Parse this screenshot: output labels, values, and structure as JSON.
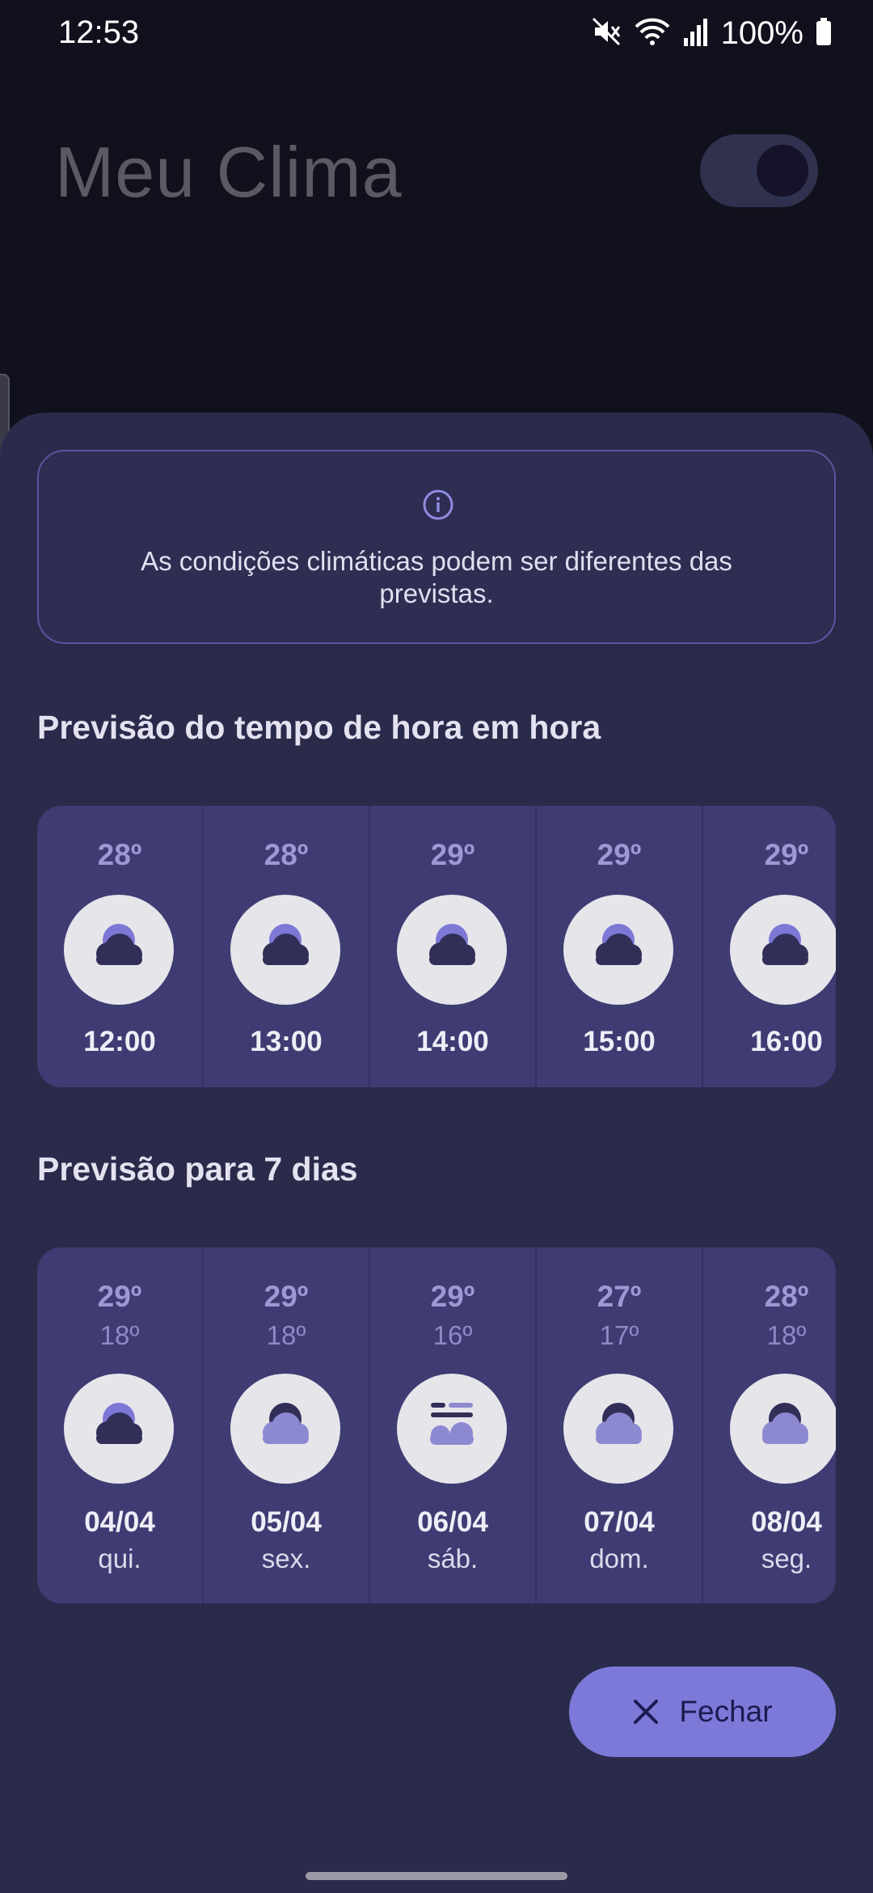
{
  "status_bar": {
    "time": "12:53",
    "battery": "100%"
  },
  "app": {
    "title": "Meu Clima"
  },
  "info": {
    "message": "As condições climáticas podem ser diferentes das previstas."
  },
  "hourly": {
    "title": "Previsão do tempo de hora em hora",
    "items": [
      {
        "temp": "28º",
        "time": "12:00",
        "icon": "partly-cloudy-night-icon"
      },
      {
        "temp": "28º",
        "time": "13:00",
        "icon": "partly-cloudy-night-icon"
      },
      {
        "temp": "29º",
        "time": "14:00",
        "icon": "partly-cloudy-night-icon"
      },
      {
        "temp": "29º",
        "time": "15:00",
        "icon": "partly-cloudy-night-icon"
      },
      {
        "temp": "29º",
        "time": "16:00",
        "icon": "partly-cloudy-night-icon"
      }
    ]
  },
  "daily": {
    "title": "Previsão para 7 dias",
    "items": [
      {
        "max": "29º",
        "min": "18º",
        "date": "04/04",
        "day": "qui.",
        "icon": "partly-cloudy-icon"
      },
      {
        "max": "29º",
        "min": "18º",
        "date": "05/04",
        "day": "sex.",
        "icon": "cloudy-icon"
      },
      {
        "max": "29º",
        "min": "16º",
        "date": "06/04",
        "day": "sáb.",
        "icon": "fog-icon"
      },
      {
        "max": "27º",
        "min": "17º",
        "date": "07/04",
        "day": "dom.",
        "icon": "cloudy-icon"
      },
      {
        "max": "28º",
        "min": "18º",
        "date": "08/04",
        "day": "seg.",
        "icon": "cloudy-icon"
      }
    ]
  },
  "actions": {
    "close_label": "Fechar"
  },
  "colors": {
    "sheet": "#2a2a4b",
    "card": "#3e3c72",
    "accent": "#7c79d8"
  }
}
